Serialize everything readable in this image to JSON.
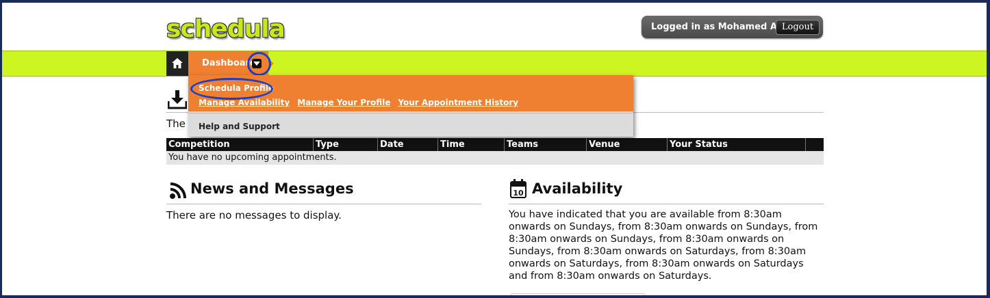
{
  "header": {
    "logo": "schedula",
    "logged_in_text": "Logged in as Mohamed Abdi",
    "logout_label": "Logout"
  },
  "nav": {
    "dashboard_label": "Dashboard"
  },
  "dropdown": {
    "profile_label": "Schedula Profile",
    "links": [
      "Manage Availability",
      "Manage Your Profile",
      "Your Appointment History"
    ],
    "help_label": "Help and Support"
  },
  "upcoming": {
    "partial_text": "The",
    "columns": [
      "Competition",
      "Type",
      "Date",
      "Time",
      "Teams",
      "Venue",
      "Your Status"
    ],
    "empty_text": "You have no upcoming appointments."
  },
  "news": {
    "title": "News and Messages",
    "empty_text": "There are no messages to display."
  },
  "availability": {
    "title": "Availability",
    "calendar_day": "10",
    "text": "You have indicated that you are available from 8:30am onwards on Sundays, from 8:30am onwards on Sundays, from 8:30am onwards on Sundays, from 8:30am onwards on Sundays, from 8:30am onwards on Saturdays, from 8:30am onwards on Saturdays, from 8:30am onwards on Saturdays and from 8:30am onwards on Saturdays."
  },
  "colors": {
    "accent_green": "#ccf522",
    "accent_orange": "#ef7f31",
    "highlight_ring": "#1c3fc7"
  }
}
